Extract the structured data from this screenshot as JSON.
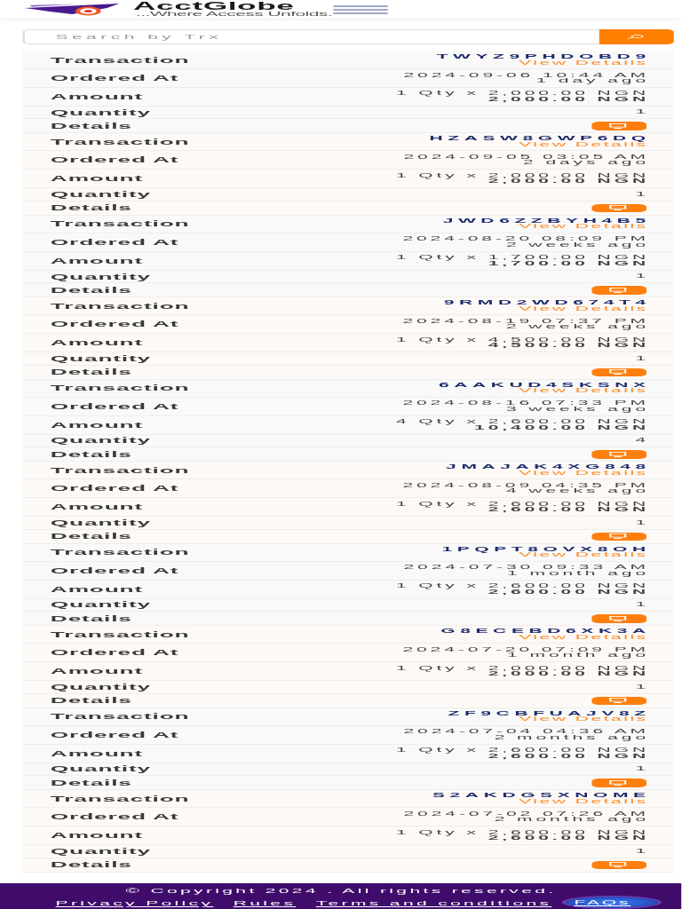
{
  "header": {
    "brand": "AcctGlobe",
    "tagline": "...Where Access Unfolds."
  },
  "search": {
    "placeholder": "Search by Trx"
  },
  "transactions": [
    {
      "fields": [
        {
          "kind": "transaction",
          "label": "Transaction",
          "value": "TWYZ9PHDOBD9",
          "link": "View Details"
        },
        {
          "kind": "ordered_at",
          "label": "Ordered At",
          "value": "2024-09-06 10:44 AM",
          "note": "1 day ago"
        },
        {
          "kind": "amount",
          "label": "Amount",
          "value": "1 Qty x 2,000.00 NGN",
          "total": "2,000.00 NGN"
        },
        {
          "kind": "quantity",
          "label": "Quantity",
          "value": "1"
        },
        {
          "kind": "details",
          "label": "Details"
        }
      ]
    },
    {
      "fields": [
        {
          "kind": "transaction",
          "label": "Transaction",
          "value": "HZASW8GWP6DQ",
          "link": "View Details"
        },
        {
          "kind": "ordered_at",
          "label": "Ordered At",
          "value": "2024-09-05 03:05 AM",
          "note": "2 days ago"
        },
        {
          "kind": "amount",
          "label": "Amount",
          "value": "1 Qty x 2,000.00 NGN",
          "total": "2,000.00 NGN"
        },
        {
          "kind": "quantity",
          "label": "Quantity",
          "value": "1"
        },
        {
          "kind": "details",
          "label": "Details"
        }
      ]
    },
    {
      "fields": [
        {
          "kind": "transaction",
          "label": "Transaction",
          "value": "JWD6ZZBYH4B5",
          "link": "View Details"
        },
        {
          "kind": "ordered_at",
          "label": "Ordered At",
          "value": "2024-08-20 08:09 PM",
          "note": "2 weeks ago"
        },
        {
          "kind": "amount",
          "label": "Amount",
          "value": "1 Qty x 1,700.00 NGN",
          "total": "1,700.00 NGN"
        },
        {
          "kind": "quantity",
          "label": "Quantity",
          "value": "1"
        },
        {
          "kind": "details",
          "label": "Details"
        }
      ]
    },
    {
      "fields": [
        {
          "kind": "transaction",
          "label": "Transaction",
          "value": "9RMD2WD674T4",
          "link": "View Details"
        },
        {
          "kind": "ordered_at",
          "label": "Ordered At",
          "value": "2024-08-19 07:37 PM",
          "note": "2 weeks ago"
        },
        {
          "kind": "amount",
          "label": "Amount",
          "value": "1 Qty x 4,500.00 NGN",
          "total": "4,500.00 NGN"
        },
        {
          "kind": "quantity",
          "label": "Quantity",
          "value": "1"
        },
        {
          "kind": "details",
          "label": "Details"
        }
      ]
    },
    {
      "fields": [
        {
          "kind": "transaction",
          "label": "Transaction",
          "value": "6AAKUD4SKSNX",
          "link": "View Details"
        },
        {
          "kind": "ordered_at",
          "label": "Ordered At",
          "value": "2024-08-16 07:33 PM",
          "note": "3 weeks ago"
        },
        {
          "kind": "amount",
          "label": "Amount",
          "value": "4 Qty x 2,600.00 NGN",
          "total": "10,400.00 NGN"
        },
        {
          "kind": "quantity",
          "label": "Quantity",
          "value": "4"
        },
        {
          "kind": "details",
          "label": "Details"
        }
      ]
    },
    {
      "fields": [
        {
          "kind": "transaction",
          "label": "Transaction",
          "value": "JMAJAK4XG848",
          "link": "View Details"
        },
        {
          "kind": "ordered_at",
          "label": "Ordered At",
          "value": "2024-08-09 04:35 PM",
          "note": "4 weeks ago"
        },
        {
          "kind": "amount",
          "label": "Amount",
          "value": "1 Qty x 2,600.00 NGN",
          "total": "2,600.00 NGN"
        },
        {
          "kind": "quantity",
          "label": "Quantity",
          "value": "1"
        },
        {
          "kind": "details",
          "label": "Details"
        }
      ]
    },
    {
      "fields": [
        {
          "kind": "transaction",
          "label": "Transaction",
          "value": "1PQPT8OVX8OH",
          "link": "View Details"
        },
        {
          "kind": "ordered_at",
          "label": "Ordered At",
          "value": "2024-07-30 09:33 AM",
          "note": "1 month ago"
        },
        {
          "kind": "amount",
          "label": "Amount",
          "value": "1 Qty x 2,600.00 NGN",
          "total": "2,600.00 NGN"
        },
        {
          "kind": "quantity",
          "label": "Quantity",
          "value": "1"
        },
        {
          "kind": "details",
          "label": "Details"
        }
      ]
    },
    {
      "fields": [
        {
          "kind": "transaction",
          "label": "Transaction",
          "value": "G8ECEBD6XK3A",
          "link": "View Details"
        },
        {
          "kind": "ordered_at",
          "label": "Ordered At",
          "value": "2024-07-20 07:09 PM",
          "note": "1 month ago"
        },
        {
          "kind": "amount",
          "label": "Amount",
          "value": "1 Qty x 2,000.00 NGN",
          "total": "2,000.00 NGN"
        },
        {
          "kind": "quantity",
          "label": "Quantity",
          "value": "1"
        },
        {
          "kind": "details",
          "label": "Details"
        }
      ]
    },
    {
      "fields": [
        {
          "kind": "transaction",
          "label": "Transaction",
          "value": "ZF9CBFUAJV8Z",
          "link": "View Details"
        },
        {
          "kind": "ordered_at",
          "label": "Ordered At",
          "value": "2024-07-04 04:36 AM",
          "note": "2 months ago"
        },
        {
          "kind": "amount",
          "label": "Amount",
          "value": "1 Qty x 2,600.00 NGN",
          "total": "2,600.00 NGN"
        },
        {
          "kind": "quantity",
          "label": "Quantity",
          "value": "1"
        },
        {
          "kind": "details",
          "label": "Details"
        }
      ]
    },
    {
      "fields": [
        {
          "kind": "transaction",
          "label": "Transaction",
          "value": "S2AKDGSXNOME",
          "link": "View Details"
        },
        {
          "kind": "ordered_at",
          "label": "Ordered At",
          "value": "2024-07-02 07:26 AM",
          "note": "2 months ago"
        },
        {
          "kind": "amount",
          "label": "Amount",
          "value": "1 Qty x 2,600.00 NGN",
          "total": "2,600.00 NGN"
        },
        {
          "kind": "quantity",
          "label": "Quantity",
          "value": "1"
        },
        {
          "kind": "details",
          "label": "Details"
        }
      ]
    }
  ],
  "footer": {
    "copyright": "© Copyright 2024 . All rights reserved.",
    "links": [
      "Privacy Policy",
      "Rules",
      "Terms and conditions"
    ],
    "help_button": {
      "label": "FAQs"
    }
  }
}
